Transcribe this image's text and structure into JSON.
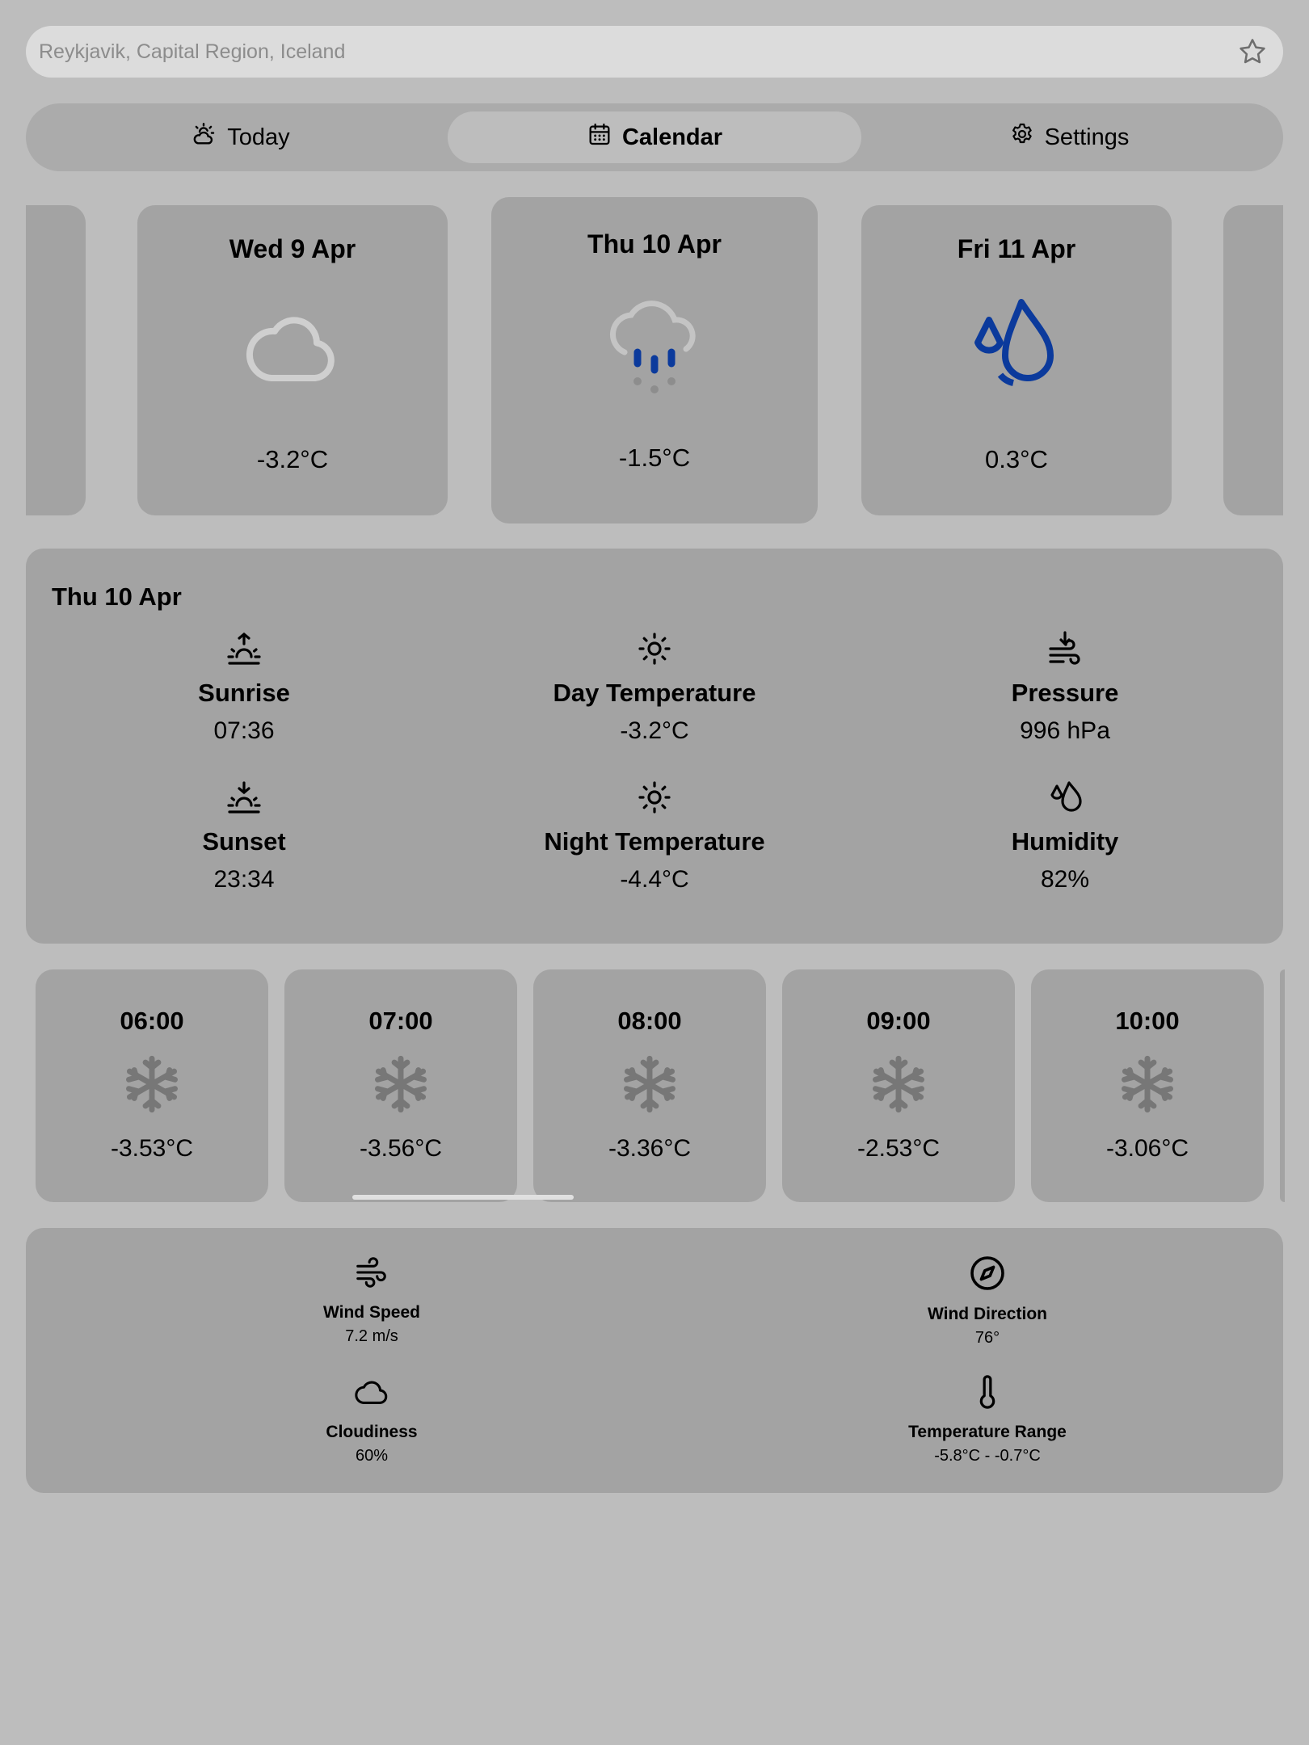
{
  "search": {
    "placeholder": "Reykjavik, Capital Region, Iceland"
  },
  "tabs": [
    {
      "label": "Today",
      "icon": "sun-cloud-icon",
      "active": false
    },
    {
      "label": "Calendar",
      "icon": "calendar-icon",
      "active": true
    },
    {
      "label": "Settings",
      "icon": "gear-icon",
      "active": false
    }
  ],
  "days": [
    {
      "name": "Wed 9 Apr",
      "icon": "cloud-icon",
      "temp": "-3.2°C"
    },
    {
      "name": "Thu 10 Apr",
      "icon": "snow-rain-icon",
      "temp": "-1.5°C",
      "selected": true
    },
    {
      "name": "Fri 11 Apr",
      "icon": "droplets-icon",
      "temp": "0.3°C"
    }
  ],
  "detail": {
    "title": "Thu 10 Apr",
    "metrics": [
      {
        "label": "Sunrise",
        "value": "07:36",
        "icon": "sunrise-icon"
      },
      {
        "label": "Day Temperature",
        "value": "-3.2°C",
        "icon": "sun-icon"
      },
      {
        "label": "Pressure",
        "value": "996 hPa",
        "icon": "pressure-icon"
      },
      {
        "label": "Sunset",
        "value": "23:34",
        "icon": "sunset-icon"
      },
      {
        "label": "Night Temperature",
        "value": "-4.4°C",
        "icon": "sun-icon"
      },
      {
        "label": "Humidity",
        "value": "82%",
        "icon": "droplets-icon"
      }
    ]
  },
  "hourly": [
    {
      "time": "06:00",
      "temp": "-3.53°C",
      "icon": "snowflake-icon"
    },
    {
      "time": "07:00",
      "temp": "-3.56°C",
      "icon": "snowflake-icon"
    },
    {
      "time": "08:00",
      "temp": "-3.36°C",
      "icon": "snowflake-icon"
    },
    {
      "time": "09:00",
      "temp": "-2.53°C",
      "icon": "snowflake-icon"
    },
    {
      "time": "10:00",
      "temp": "-3.06°C",
      "icon": "snowflake-icon"
    }
  ],
  "extra": [
    {
      "label": "Wind Speed",
      "value": "7.2 m/s",
      "icon": "wind-icon"
    },
    {
      "label": "Wind Direction",
      "value": "76°",
      "icon": "compass-icon"
    },
    {
      "label": "Cloudiness",
      "value": "60%",
      "icon": "cloud-icon"
    },
    {
      "label": "Temperature Range",
      "value": "-5.8°C - -0.7°C",
      "icon": "thermometer-icon"
    }
  ],
  "colors": {
    "background": "#bdbdbd",
    "card": "#a3a3a3",
    "accent_blue": "#0b3a9c",
    "icon_gray": "#777777"
  }
}
